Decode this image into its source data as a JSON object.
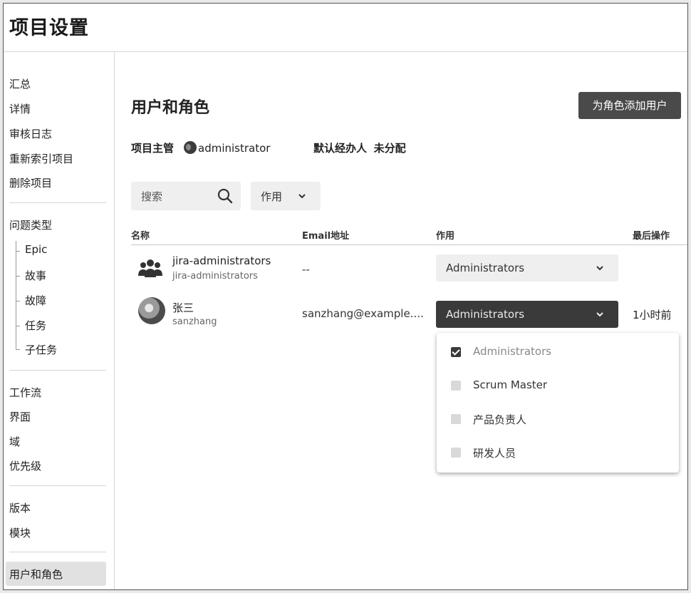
{
  "header": {
    "title": "项目设置"
  },
  "sidebar": {
    "groups": [
      [
        "汇总",
        "详情",
        "审核日志",
        "重新索引项目",
        "删除项目"
      ],
      [
        "问题类型"
      ],
      [
        "工作流",
        "界面",
        "域",
        "优先级"
      ],
      [
        "版本",
        "模块"
      ],
      [
        "用户和角色"
      ]
    ],
    "issue_types": [
      "Epic",
      "故事",
      "故障",
      "任务",
      "子任务"
    ],
    "active": "用户和角色"
  },
  "main": {
    "title": "用户和角色",
    "add_button": "为角色添加用户",
    "project_lead_label": "项目主管",
    "project_lead": "administrator",
    "default_assignee_label": "默认经办人",
    "default_assignee": "未分配",
    "search_placeholder": "搜索",
    "role_filter": "作用",
    "columns": [
      "名称",
      "Email地址",
      "作用",
      "最后操作"
    ],
    "rows": [
      {
        "name": "jira-administrators",
        "sub": "jira-administrators",
        "email": "--",
        "role": "Administrators",
        "last": "",
        "avatar": "group-icon"
      },
      {
        "name": "张三",
        "sub": "sanzhang",
        "email": "sanzhang@example....",
        "role": "Administrators",
        "last": "1小时前",
        "avatar": "user-photo"
      }
    ],
    "role_dropdown": {
      "options": [
        {
          "label": "Administrators",
          "checked": true
        },
        {
          "label": "Scrum Master",
          "checked": false
        },
        {
          "label": "产品负责人",
          "checked": false
        },
        {
          "label": "研发人员",
          "checked": false
        }
      ]
    }
  },
  "colors": {
    "dark_button": "#4a4a4a",
    "selected_role": "#3a3a3a",
    "light_fill": "#efefef"
  }
}
